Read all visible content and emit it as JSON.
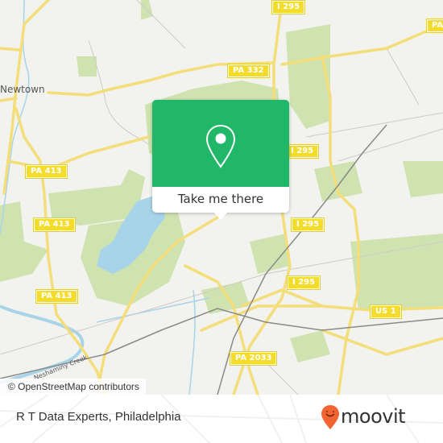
{
  "map": {
    "place_labels": [
      {
        "name": "Newtown"
      }
    ],
    "water_labels": [
      {
        "name": "Neshaminy Creek"
      }
    ],
    "road_shields": [
      {
        "label": "I 295"
      },
      {
        "label": "PA 332"
      },
      {
        "label": "PA 332"
      },
      {
        "label": "PA 413"
      },
      {
        "label": "PA 413"
      },
      {
        "label": "PA 413"
      },
      {
        "label": "I 295"
      },
      {
        "label": "I 295"
      },
      {
        "label": "I 295"
      },
      {
        "label": "US 1"
      },
      {
        "label": "PA 2033"
      },
      {
        "label": "PA"
      }
    ],
    "attribution": "© OpenStreetMap contributors"
  },
  "popup": {
    "button_label": "Take me there",
    "icon": "location-pin-icon",
    "color": "#20b868"
  },
  "footer": {
    "title": "R T Data Experts, Philadelphia",
    "brand": "moovit",
    "brand_color": "#f26532"
  }
}
